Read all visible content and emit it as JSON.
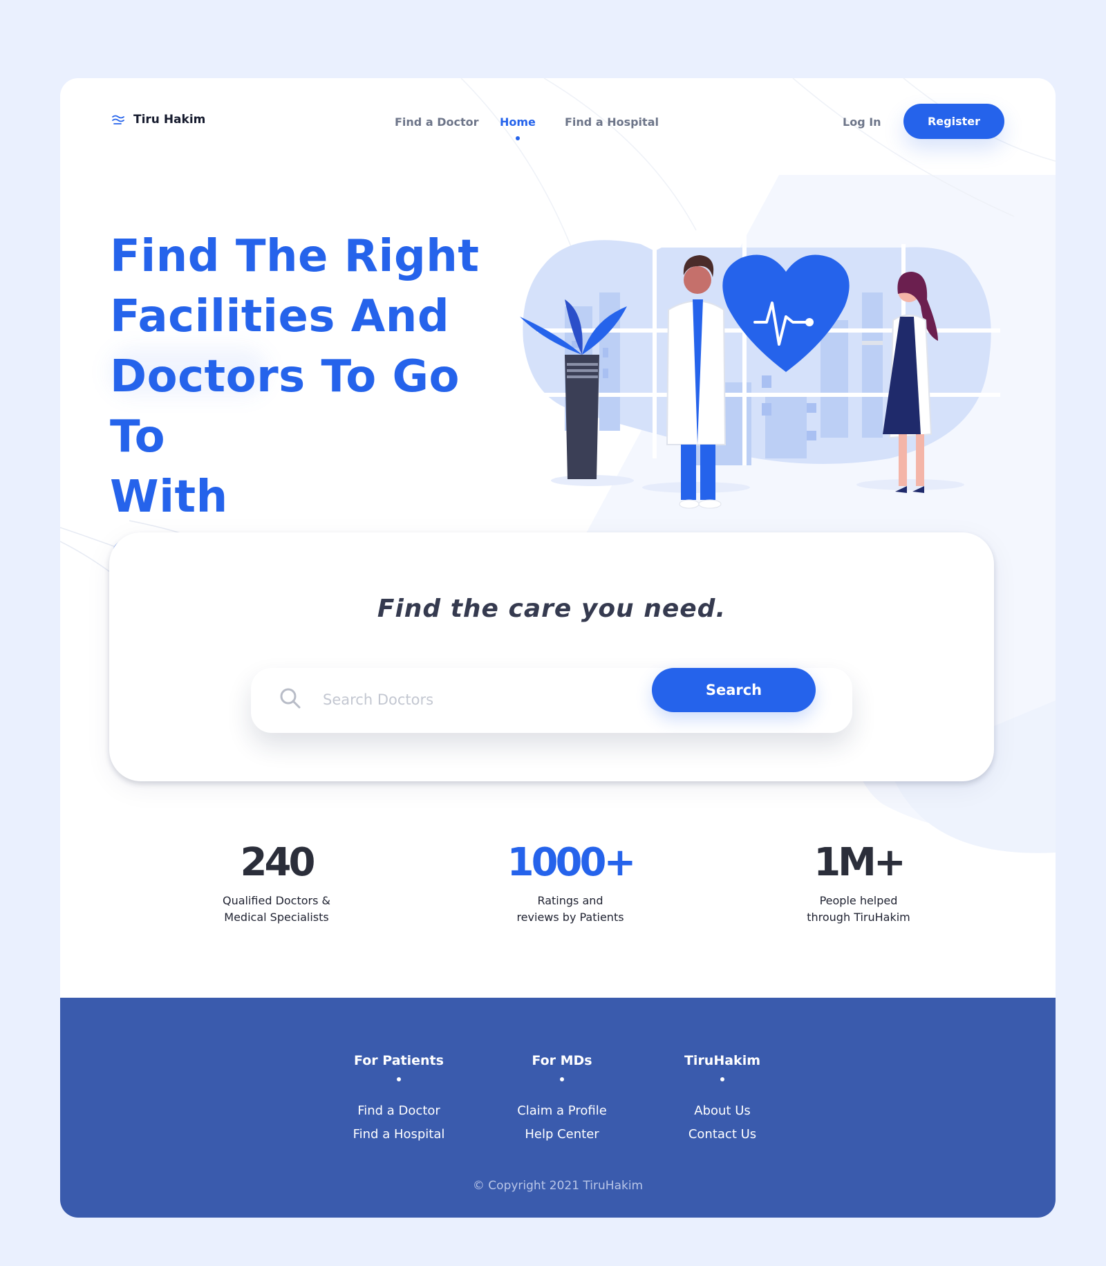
{
  "header": {
    "brand": "Tiru Hakim",
    "nav": {
      "find_doctor": "Find a Doctor",
      "home": "Home",
      "find_hospital": "Find a Hospital"
    },
    "login": "Log In",
    "register": "Register"
  },
  "hero": {
    "title_lines": [
      "Find The Right",
      "Facilities And",
      "Doctors To Go To",
      "With Confidence"
    ]
  },
  "search": {
    "tagline": "Find the care you need.",
    "placeholder": "Search Doctors",
    "button": "Search"
  },
  "stats": [
    {
      "value": "240",
      "label_lines": [
        "Qualified Doctors &",
        "Medical Specialists"
      ]
    },
    {
      "value": "1000+",
      "label_lines": [
        "Ratings and",
        "reviews by Patients"
      ]
    },
    {
      "value": "1M+",
      "label_lines": [
        "People helped",
        "through TiruHakim"
      ]
    }
  ],
  "footer": {
    "columns": [
      {
        "heading": "For Patients",
        "links": [
          "Find a Doctor",
          "Find a Hospital"
        ]
      },
      {
        "heading": "For MDs",
        "links": [
          "Claim a Profile",
          "Help Center"
        ]
      },
      {
        "heading": "TiruHakim",
        "links": [
          "About Us",
          "Contact Us"
        ]
      }
    ],
    "copyright": "© Copyright 2021 TiruHakim"
  },
  "colors": {
    "accent": "#2563eb",
    "footer_bg": "#3a5bad",
    "page_bg": "#eaf0fe"
  },
  "icons": [
    "logo-waves-icon",
    "search-icon",
    "heart-pulse-icon"
  ]
}
